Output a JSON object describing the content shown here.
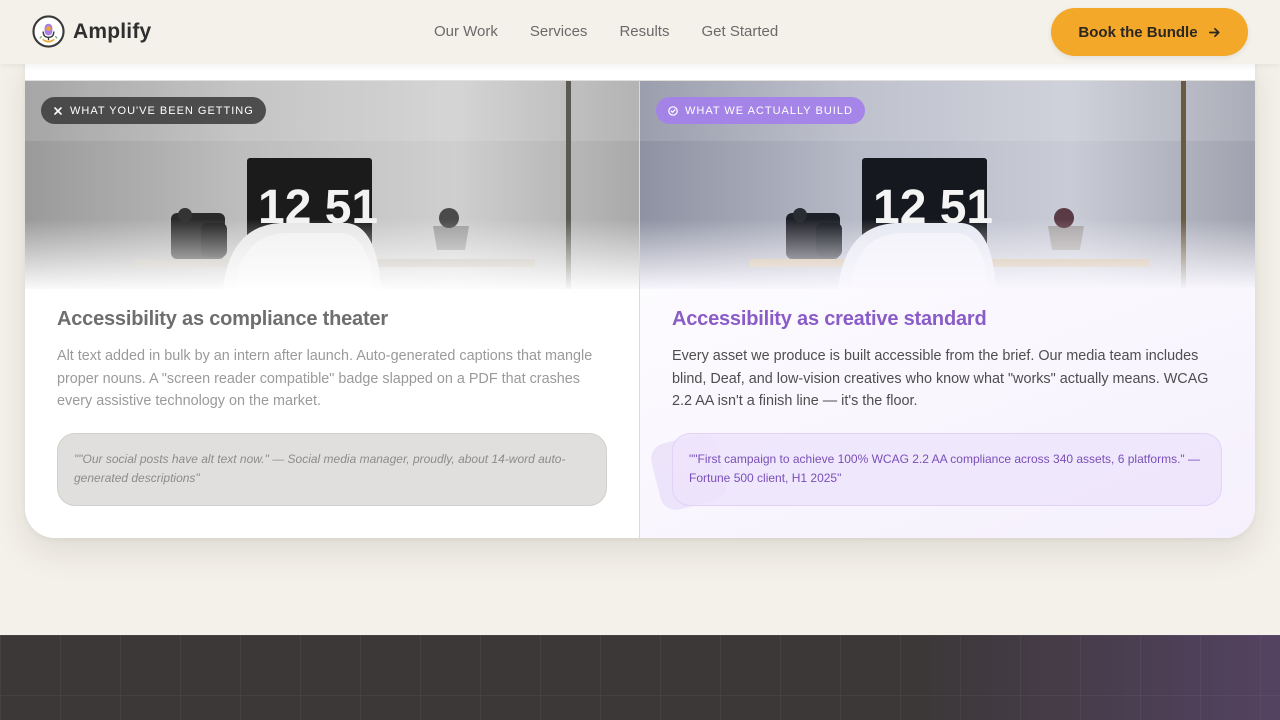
{
  "header": {
    "brand": "Amplify",
    "nav": [
      "Our Work",
      "Services",
      "Results",
      "Get Started"
    ],
    "cta_label": "Book the Bundle"
  },
  "comparison": {
    "before": {
      "tag": "WHAT YOU'VE BEEN GETTING",
      "clock": "12 51",
      "title": "Accessibility as compliance theater",
      "body": "Alt text added in bulk by an intern after launch. Auto-generated captions that mangle proper nouns. A \"screen reader compatible\" badge slapped on a PDF that crashes every assistive technology on the market.",
      "quote": "\"\"Our social posts have alt text now.\" — Social media manager, proudly, about 14-word auto-generated descriptions\""
    },
    "after": {
      "tag": "WHAT WE ACTUALLY BUILD",
      "clock": "12 51",
      "title": "Accessibility as creative standard",
      "body": "Every asset we produce is built accessible from the brief. Our media team includes blind, Deaf, and low-vision creatives who know what \"works\" actually means. WCAG 2.2 AA isn't a finish line — it's the floor.",
      "quote": "\"\"First campaign to achieve 100% WCAG 2.2 AA compliance across 340 assets, 6 platforms.\" — Fortune 500 client, H1 2025\""
    }
  },
  "colors": {
    "accent": "#f3a82a",
    "purple": "#8a5cc8",
    "background": "#f4f1ea",
    "band": "#3c3838"
  },
  "icons": {
    "logo": "microphone-badge-icon",
    "cta": "arrow-right-icon",
    "before_tag": "x-icon",
    "after_tag": "check-circle-icon"
  }
}
